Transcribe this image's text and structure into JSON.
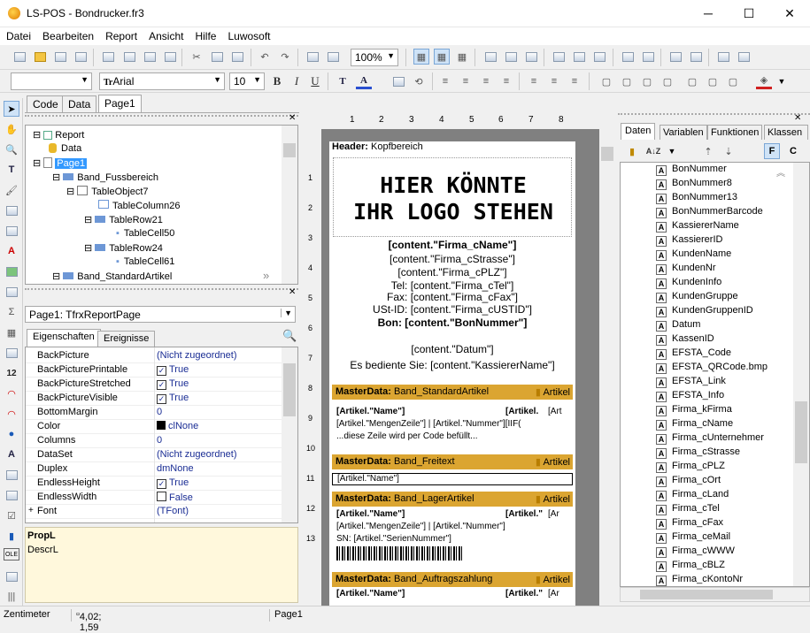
{
  "window": {
    "app": "LS-POS",
    "sep": "-",
    "file": "Bondrucker.fr3",
    "min": "─",
    "max": "☐",
    "close": "✕"
  },
  "menu": [
    "Datei",
    "Bearbeiten",
    "Report",
    "Ansicht",
    "Hilfe",
    "Luwosoft"
  ],
  "toolbar": {
    "zoom": "100%",
    "font": "Arial",
    "size": "10",
    "bold": "B",
    "italic": "I",
    "underline": "U",
    "font_icon": "Tr"
  },
  "left_tabs": [
    "Code",
    "Data",
    "Page1"
  ],
  "tree": [
    "Report",
    "Data",
    "Page1",
    "Band_Fussbereich",
    "TableObject7",
    "TableColumn26",
    "TableRow21",
    "TableCell50",
    "TableRow24",
    "TableCell61",
    "Band_StandardArtikel"
  ],
  "object_selector": "Page1: TfrxReportPage",
  "inspector_tabs": [
    "Eigenschaften",
    "Ereignisse"
  ],
  "props": [
    {
      "name": "BackPicture",
      "value": "(Nicht zugeordnet)"
    },
    {
      "name": "BackPicturePrintable",
      "value": "True",
      "check": "✓"
    },
    {
      "name": "BackPictureStretched",
      "value": "True",
      "check": "✓"
    },
    {
      "name": "BackPictureVisible",
      "value": "True",
      "check": "✓"
    },
    {
      "name": "BottomMargin",
      "value": "0"
    },
    {
      "name": "Color",
      "value": "clNone"
    },
    {
      "name": "Columns",
      "value": "0"
    },
    {
      "name": "DataSet",
      "value": "(Nicht zugeordnet)"
    },
    {
      "name": "Duplex",
      "value": "dmNone"
    },
    {
      "name": "EndlessHeight",
      "value": "True",
      "check": "✓"
    },
    {
      "name": "EndlessWidth",
      "value": "False",
      "check": ""
    },
    {
      "name": "Font",
      "value": "(TFont)",
      "expand": "+"
    }
  ],
  "desc": {
    "title": "PropL",
    "text": "DescrL"
  },
  "report": {
    "header_label": "Header:",
    "header_name": "Kopfbereich",
    "logo1": "HIER KÖNNTE",
    "logo2": "IHR LOGO STEHEN",
    "lines": [
      "[content.\"Firma_cName\"]",
      "[content.\"Firma_cStrasse\"]",
      "[content.\"Firma_cPLZ\"]",
      "Tel: [content.\"Firma_cTel\"]",
      "Fax: [content.\"Firma_cFax\"]",
      "USt-ID: [content.\"Firma_cUSTID\"]",
      "Bon: [content.\"BonNummer\"]"
    ],
    "datum": "[content.\"Datum\"]",
    "bedient": "Es bediente Sie: [content.\"KassiererName\"]",
    "bands": [
      {
        "label": "MasterData:",
        "name": "Band_StandardArtikel",
        "ds": "Artikel"
      },
      {
        "label": "MasterData:",
        "name": "Band_Freitext",
        "ds": "Artikel"
      },
      {
        "label": "MasterData:",
        "name": "Band_LagerArtikel",
        "ds": "Artikel"
      },
      {
        "label": "MasterData:",
        "name": "Band_Auftragszahlung",
        "ds": "Artikel"
      }
    ],
    "std1": "[Artikel.\"Name\"]",
    "std1b": "[Artikel.",
    "std1c": "[Art",
    "std2": "[Artikel.\"MengenZeile\"] | [Artikel.\"Nummer\"][IIF(",
    "std3": "...diese Zeile wird per Code befüllt...",
    "frei": "[Artikel.\"Name\"]",
    "lag1": "[Artikel.\"Name\"]",
    "lag1b": "[Artikel.\"",
    "lag1c": "[Ar",
    "lag2": "[Artikel.\"MengenZeile\"] | [Artikel.\"Nummer\"]",
    "lag3": "SN: [Artikel.\"SerienNummer\"]",
    "auf1": "[Artikel.\"Name\"]",
    "auf1b": "[Artikel.\"",
    "auf1c": "[Ar"
  },
  "ruler": [
    "1",
    "2",
    "3",
    "4",
    "5",
    "6",
    "7",
    "8"
  ],
  "vruler": [
    "1",
    "2",
    "3",
    "4",
    "5",
    "6",
    "7",
    "8",
    "9",
    "10",
    "11",
    "12",
    "13"
  ],
  "right_tabs": [
    "Daten",
    "Variablen",
    "Funktionen",
    "Klassen"
  ],
  "fields": [
    "BonNummer",
    "BonNummer8",
    "BonNummer13",
    "BonNummerBarcode",
    "KassiererName",
    "KassiererID",
    "KundenName",
    "KundenNr",
    "KundenInfo",
    "KundenGruppe",
    "KundenGruppenID",
    "Datum",
    "KassenID",
    "EFSTA_Code",
    "EFSTA_QRCode.bmp",
    "EFSTA_Link",
    "EFSTA_Info",
    "Firma_kFirma",
    "Firma_cName",
    "Firma_cUnternehmer",
    "Firma_cStrasse",
    "Firma_cPLZ",
    "Firma_cOrt",
    "Firma_cLand",
    "Firma_cTel",
    "Firma_cFax",
    "Firma_ceMail",
    "Firma_cWWW",
    "Firma_cBLZ",
    "Firma_cKontoNr"
  ],
  "status": {
    "unit": "Zentimeter",
    "coords": "4,02; 1,59",
    "page": "Page1"
  }
}
